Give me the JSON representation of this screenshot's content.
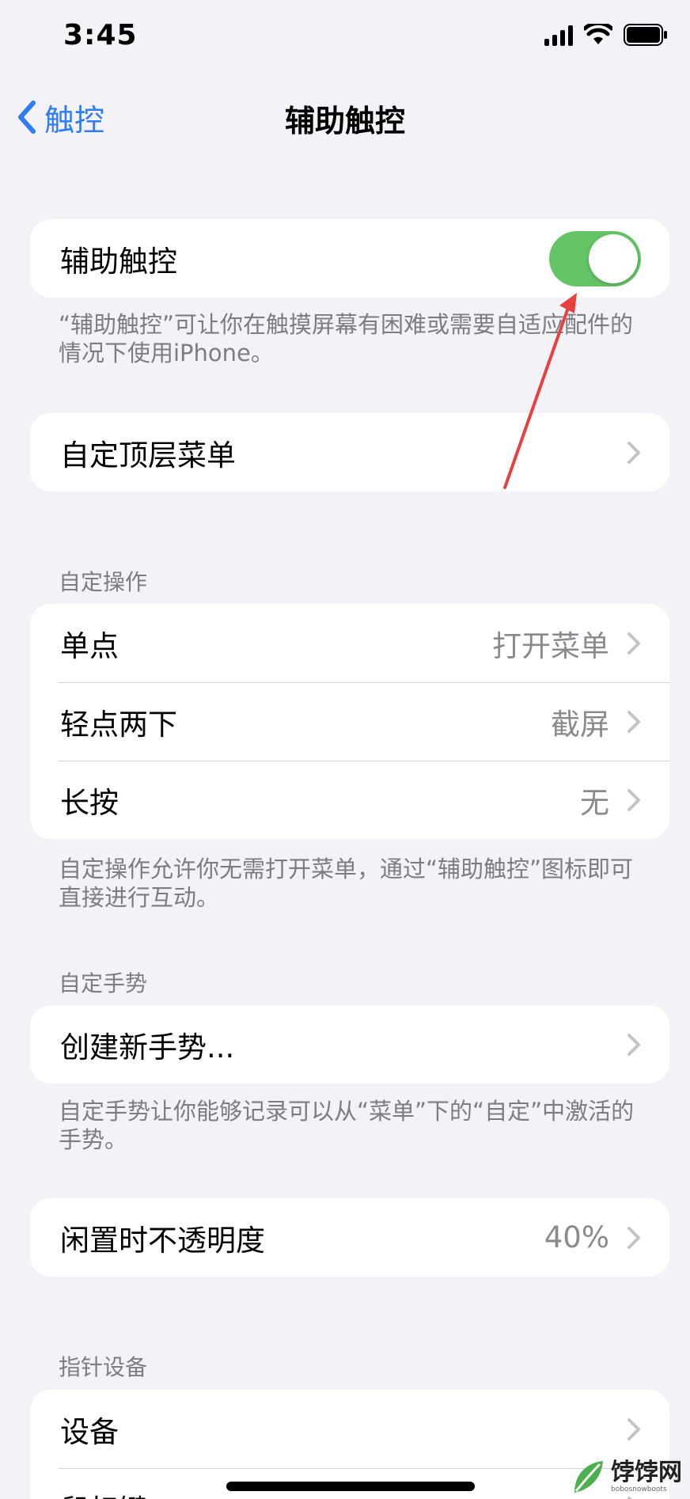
{
  "status_bar": {
    "time": "3:45"
  },
  "nav": {
    "back_label": "触控",
    "title": "辅助触控"
  },
  "assistive_touch": {
    "label": "辅助触控",
    "enabled": true
  },
  "assistive_touch_note": "“辅助触控”可让你在触摸屏幕有困难或需要自适应配件的情况下使用iPhone。",
  "top_menu": {
    "label": "自定顶层菜单"
  },
  "custom_actions": {
    "header": "自定操作",
    "items": [
      {
        "label": "单点",
        "value": "打开菜单"
      },
      {
        "label": "轻点两下",
        "value": "截屏"
      },
      {
        "label": "长按",
        "value": "无"
      }
    ],
    "note": "自定操作允许你无需打开菜单，通过“辅助触控”图标即可直接进行互动。"
  },
  "custom_gestures": {
    "header": "自定手势",
    "create_label": "创建新手势...",
    "note": "自定手势让你能够记录可以从“菜单”下的“自定”中激活的手势。"
  },
  "idle_opacity": {
    "label": "闲置时不透明度",
    "value": "40%"
  },
  "pointer_devices": {
    "header": "指针设备",
    "items": [
      {
        "label": "设备"
      },
      {
        "label": "鼠标键"
      }
    ]
  },
  "watermark": {
    "text": "饽饽网",
    "sub": "bobosnowboots"
  },
  "colors": {
    "accent": "#2f7cf6",
    "toggle_on": "#65c466",
    "annotation_arrow": "#e8403f"
  }
}
